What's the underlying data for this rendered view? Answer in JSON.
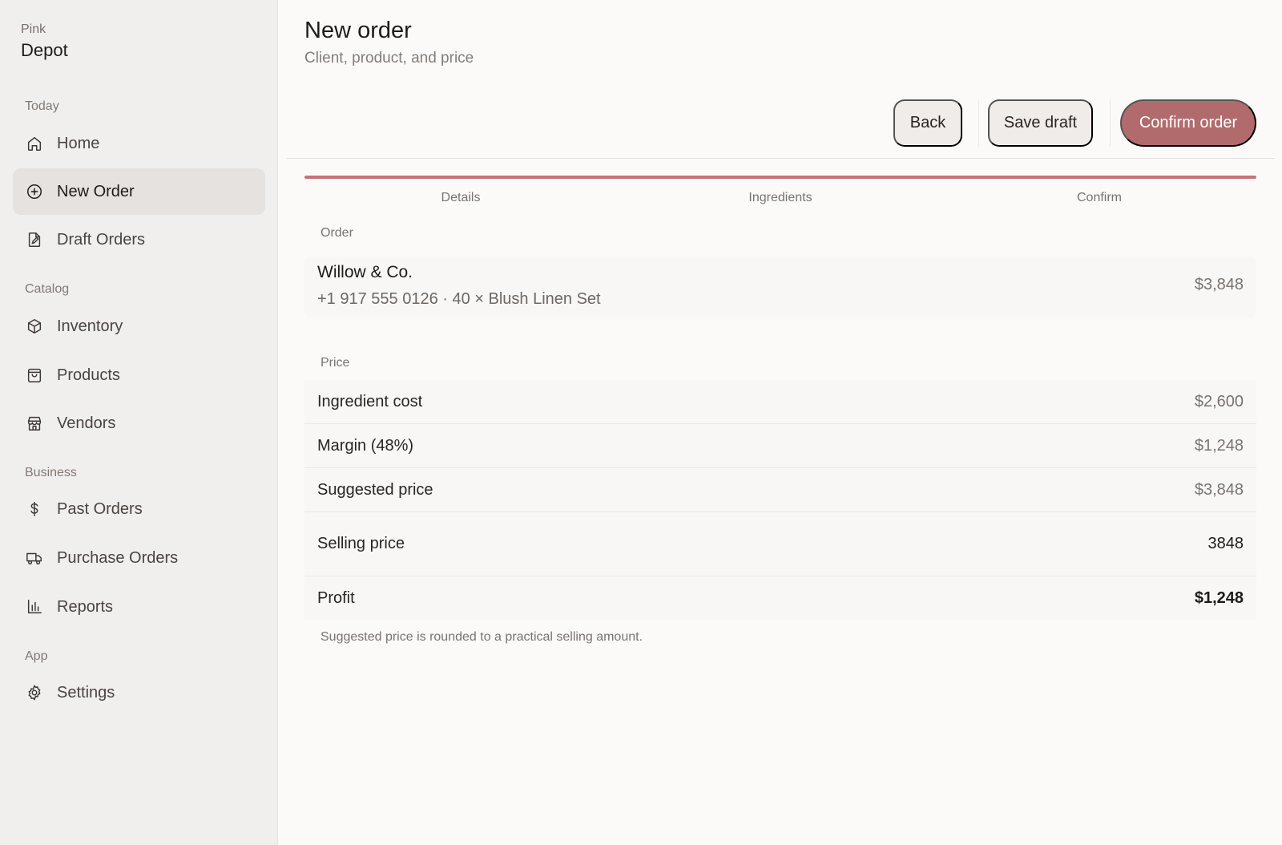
{
  "brand": {
    "small": "Pink",
    "big": "Depot"
  },
  "sidebar": {
    "sections": [
      "Today",
      "Catalog",
      "Business",
      "App"
    ],
    "items": [
      {
        "label": "Home",
        "icon": "home-icon"
      },
      {
        "label": "New Order",
        "icon": "plus-circle-icon",
        "active": true
      },
      {
        "label": "Draft Orders",
        "icon": "file-edit-icon"
      },
      {
        "label": "Inventory",
        "icon": "box-icon"
      },
      {
        "label": "Products",
        "icon": "shopping-bag-icon"
      },
      {
        "label": "Vendors",
        "icon": "store-icon"
      },
      {
        "label": "Past Orders",
        "icon": "dollar-icon"
      },
      {
        "label": "Purchase Orders",
        "icon": "truck-icon"
      },
      {
        "label": "Reports",
        "icon": "bar-chart-icon"
      },
      {
        "label": "Settings",
        "icon": "gear-icon"
      }
    ]
  },
  "header": {
    "title": "New order",
    "subtitle": "Client, product, and price",
    "back_label": "Back",
    "save_label": "Save draft",
    "confirm_label": "Confirm order"
  },
  "steps": [
    "Details",
    "Ingredients",
    "Confirm"
  ],
  "progress": 1.0,
  "order": {
    "section_label": "Order",
    "client": "Willow & Co.",
    "detail": "+1 917 555 0126 · 40 × Blush Linen Set",
    "total": "$3,848"
  },
  "price": {
    "section_label": "Price",
    "rows": [
      {
        "label": "Ingredient cost",
        "value": "$2,600"
      },
      {
        "label": "Margin (48%)",
        "value": "$1,248"
      },
      {
        "label": "Suggested price",
        "value": "$3,848"
      }
    ],
    "selling_label": "Selling price",
    "selling_value": "3848",
    "profit_label": "Profit",
    "profit_value": "$1,248"
  },
  "footnote": "Suggested price is rounded to a practical selling amount.",
  "colors": {
    "accent": "#b26b6c",
    "progress": "#c27577",
    "sidebar_bg": "#f1efee",
    "page_bg": "#fbfaf9"
  }
}
